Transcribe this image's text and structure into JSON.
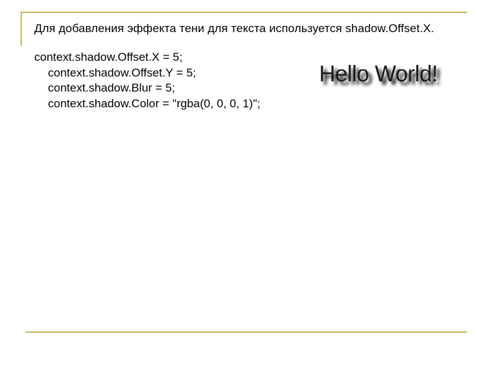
{
  "slide": {
    "title": "Для добавления эффекта тени для текста используется shadow.Offset.X.",
    "code_lines": [
      "context.shadow.Offset.X = 5;",
      "context.shadow.Offset.Y = 5;",
      "context.shadow.Blur = 5;",
      "context.shadow.Color = \"rgba(0, 0, 0, 1)\";"
    ],
    "demo_text": "Hello World!"
  },
  "colors": {
    "frame_accent": "#c8b560",
    "text": "#000000",
    "background": "#ffffff"
  }
}
